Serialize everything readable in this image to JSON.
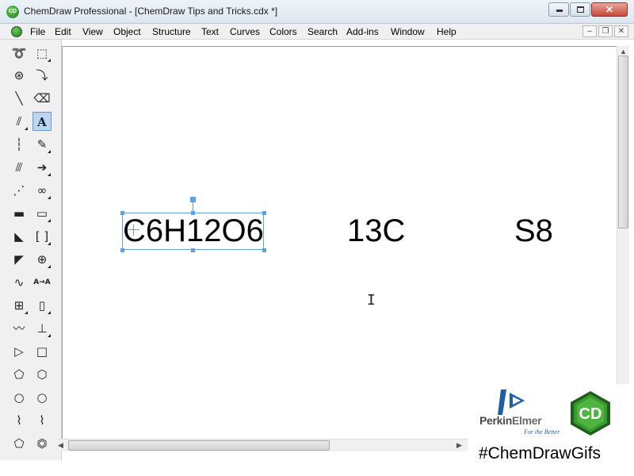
{
  "window": {
    "title": "ChemDraw Professional - [ChemDraw Tips and Tricks.cdx *]",
    "app_icon_text": "CD"
  },
  "menu": {
    "items": [
      "File",
      "Edit",
      "View",
      "Object",
      "Structure",
      "Text",
      "Curves",
      "Colors",
      "Search",
      "Add-ins",
      "Window",
      "Help"
    ]
  },
  "toolbox": {
    "tools": [
      "lasso-icon",
      "marquee-select-icon",
      "structure-perspective-icon",
      "bond-line-dashed-icon",
      "solid-bond-icon",
      "eraser-icon",
      "double-bond-icon",
      "text-tool-icon",
      "dashed-bond-icon",
      "pen-icon",
      "hashed-bond-icon",
      "arrow-icon",
      "hashed-wedge-icon",
      "orbital-icon",
      "bold-bond-icon",
      "drawing-elements-icon",
      "wedge-bond-icon",
      "brackets-icon",
      "wedged-hash-icon",
      "chemical-symbol-icon",
      "wavy-bond-icon",
      "atom-mapping-icon",
      "table-icon",
      "tlc-plate-icon",
      "chain-icon",
      "stamp-icon",
      "triangle-icon",
      "square-icon",
      "pentagon-icon",
      "hexagon-icon",
      "cyclopentane-icon",
      "cyclohexane-icon",
      "chair-icon",
      "chair-2-icon",
      "cyclopentadiene-icon",
      "benzene-icon"
    ],
    "active_tool": "text-tool-icon",
    "text_tool_label": "A",
    "chem_symbol_label": "A→A"
  },
  "canvas": {
    "texts": [
      "C6H12O6",
      "13C",
      "S8"
    ]
  },
  "branding": {
    "company_prefix": "Perkin",
    "company_suffix": "Elmer",
    "tagline": "For the Better",
    "badge_text": "CD",
    "hashtag": "#ChemDrawGifs"
  },
  "colors": {
    "selection": "#5ea0e0",
    "badge_green": "#2f8f2a",
    "perkinelmer_blue": "#1c5fa8"
  }
}
